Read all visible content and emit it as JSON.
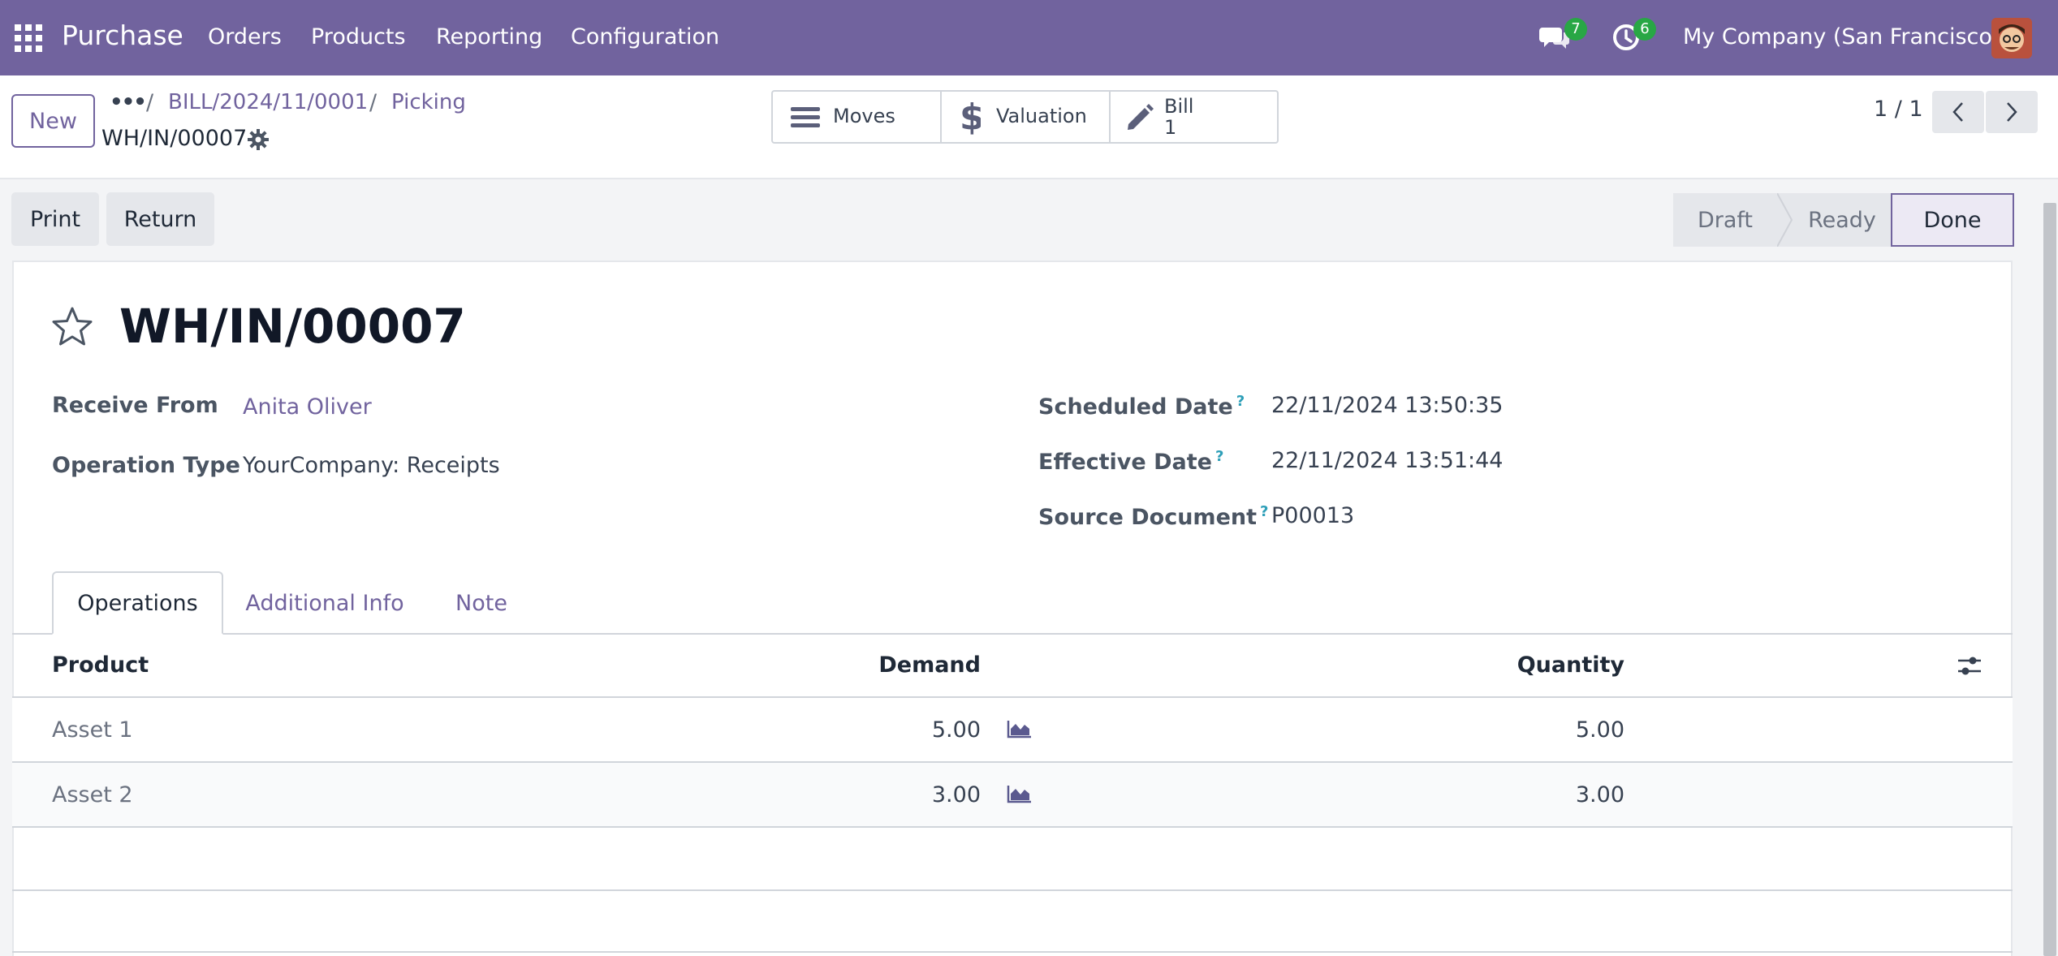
{
  "navbar": {
    "app_name": "Purchase",
    "menu": [
      "Orders",
      "Products",
      "Reporting",
      "Configuration"
    ],
    "messages_count": "7",
    "activities_count": "6",
    "company": "My Company (San Francisco)",
    "icons": {
      "apps": "apps-grid-icon",
      "messages": "chat-bubbles-icon",
      "activities": "clock-icon"
    },
    "accent_color": "#71639e",
    "badge_color": "#28a745"
  },
  "control_panel": {
    "new_label": "New",
    "breadcrumb": {
      "dots": "•••",
      "items": [
        "BILL/2024/11/0001",
        "Picking"
      ],
      "separator": "/"
    },
    "record_name": "WH/IN/00007",
    "smart_buttons": {
      "moves": "Moves",
      "valuation": "Valuation",
      "bill_label": "Bill",
      "bill_count": "1"
    },
    "pager": "1 / 1"
  },
  "actions": {
    "print": "Print",
    "return": "Return"
  },
  "statusbar": {
    "steps": [
      "Draft",
      "Ready",
      "Done"
    ],
    "current": "Done"
  },
  "record": {
    "title": "WH/IN/00007",
    "fields_left": [
      {
        "label": "Receive From",
        "value": "Anita Oliver"
      },
      {
        "label": "Operation Type",
        "value": "YourCompany: Receipts"
      }
    ],
    "fields_right": [
      {
        "label": "Scheduled Date",
        "help": "?",
        "value": "22/11/2024 13:50:35"
      },
      {
        "label": "Effective Date",
        "help": "?",
        "value": "22/11/2024 13:51:44"
      },
      {
        "label": "Source Document",
        "help": "?",
        "value": "P00013"
      }
    ]
  },
  "tabs": [
    "Operations",
    "Additional Info",
    "Note"
  ],
  "operations_table": {
    "columns": [
      "Product",
      "Demand",
      "Quantity"
    ],
    "rows": [
      {
        "product": "Asset 1",
        "demand": "5.00",
        "quantity": "5.00"
      },
      {
        "product": "Asset 2",
        "demand": "3.00",
        "quantity": "3.00"
      }
    ]
  }
}
